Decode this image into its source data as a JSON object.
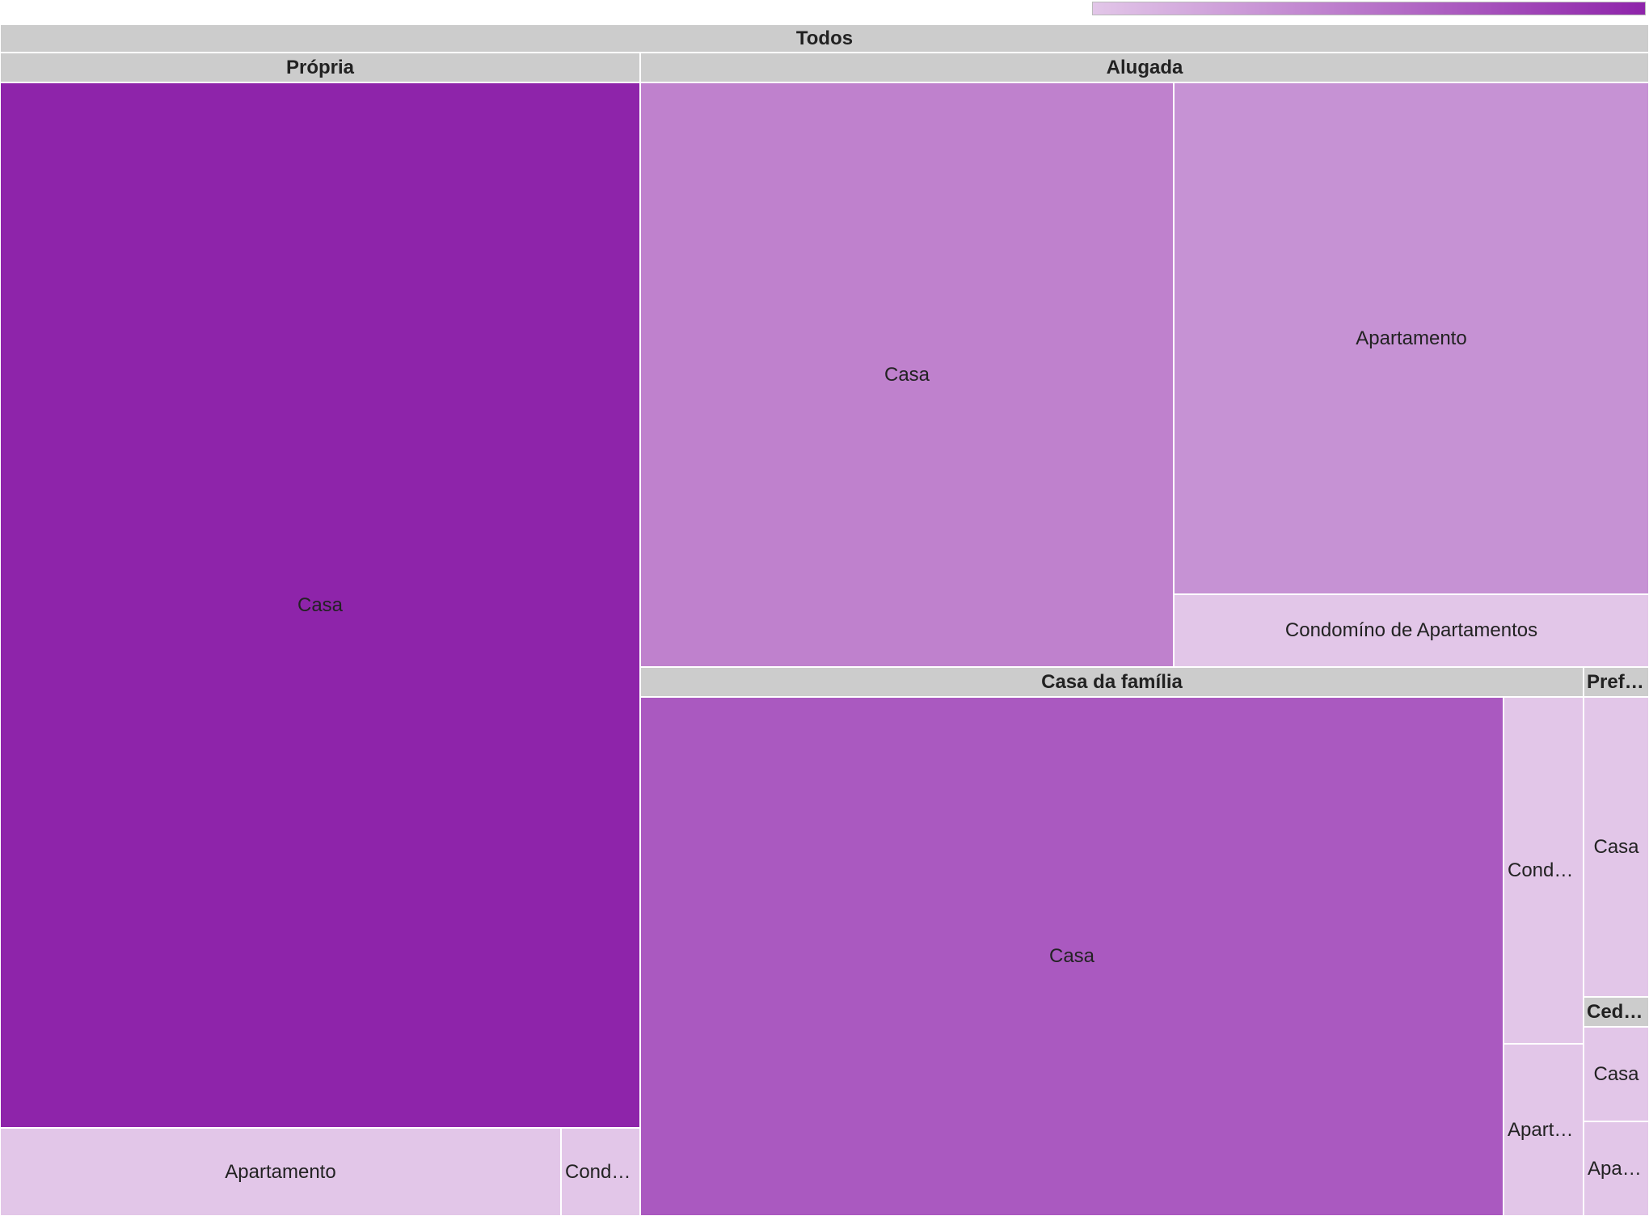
{
  "chart_data": {
    "type": "treemap",
    "root": "Todos",
    "color_scale": {
      "min_color": "#e2c6e8",
      "max_color": "#8e24aa"
    },
    "groups": [
      {
        "name": "Própria",
        "children": [
          {
            "name": "Casa",
            "value": 1007,
            "color": "#8e24aa"
          },
          {
            "name": "Apartamento",
            "value": 66,
            "color": "#e2c6e8"
          },
          {
            "name": "Condomíno de Apartamentos",
            "label": "Condo…",
            "value": 10,
            "color": "#e2c6e8"
          }
        ]
      },
      {
        "name": "Alugada",
        "children": [
          {
            "name": "Casa",
            "value": 378,
            "color": "#bf81cd"
          },
          {
            "name": "Apartamento",
            "value": 295,
            "color": "#c692d4"
          },
          {
            "name": "Condomíno de Apartamentos",
            "value": 42,
            "color": "#e2c6e8"
          }
        ]
      },
      {
        "name": "Casa da família",
        "children": [
          {
            "name": "Casa",
            "value": 541,
            "color": "#aa59c0"
          },
          {
            "name": "Condomíno de Apartamentos",
            "label": "Condo…",
            "value": 33,
            "color": "#e2c6e8"
          },
          {
            "name": "Apartamento",
            "label": "Aparta…",
            "value": 16,
            "color": "#e2c6e8"
          }
        ]
      },
      {
        "name": "Prefiro não responder",
        "label": "Prefir…",
        "children": [
          {
            "name": "Casa",
            "value": 21,
            "color": "#e2c6e8"
          }
        ]
      },
      {
        "name": "Cedida",
        "children": [
          {
            "name": "Casa",
            "value": 6,
            "color": "#e2c6e8"
          },
          {
            "name": "Apartamento",
            "label": "Apart…",
            "value": 4,
            "color": "#e2c6e8"
          }
        ]
      }
    ]
  }
}
